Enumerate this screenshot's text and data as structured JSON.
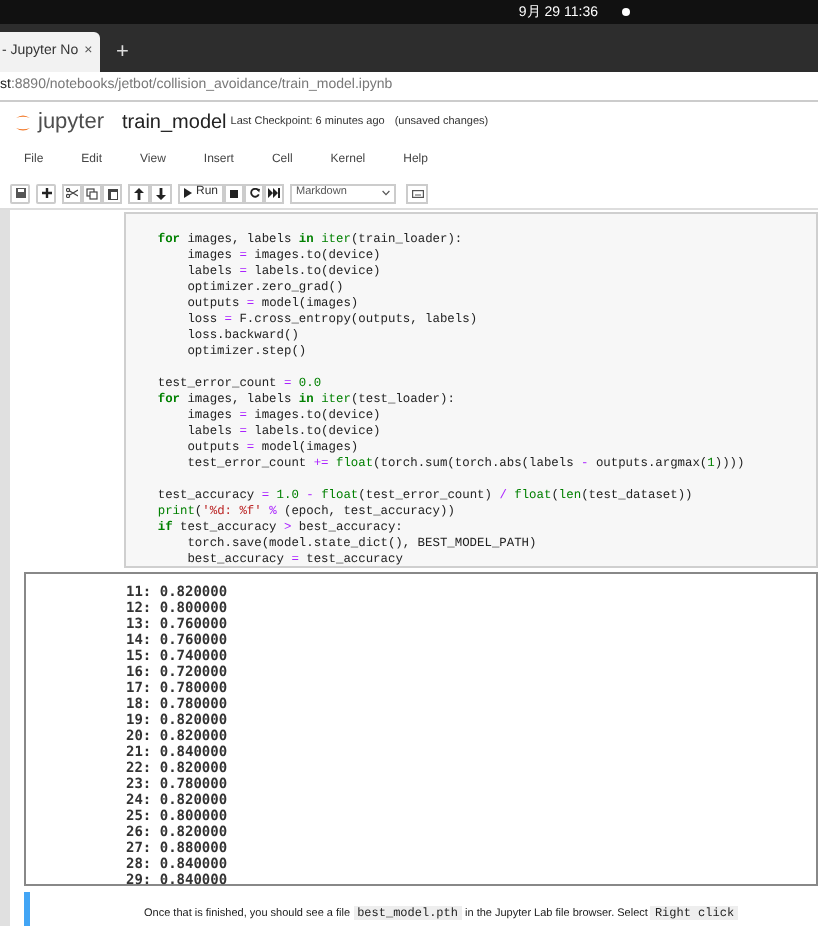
{
  "system_bar": {
    "clock": "9月 29 11:36"
  },
  "browser": {
    "tab": {
      "title": "- Jupyter No",
      "close": "×"
    },
    "new_tab": "+",
    "url": {
      "host": "st",
      "path": ":8890/notebooks/jetbot/collision_avoidance/train_model.ipynb"
    }
  },
  "header": {
    "logo": "jupyter",
    "notebook": "train_model",
    "checkpoint": "Last Checkpoint: 6 minutes ago",
    "unsaved": "(unsaved changes)"
  },
  "menu": [
    "File",
    "Edit",
    "View",
    "Insert",
    "Cell",
    "Kernel",
    "Help"
  ],
  "toolbar": {
    "run": "Run",
    "cell_type": "Markdown"
  },
  "code": [
    {
      "gap_before": false,
      "tokens": [
        {
          "kind": "kw",
          "t": "    for"
        },
        {
          "kind": "p",
          "t": " images, labels "
        },
        {
          "kind": "kw",
          "t": "in"
        },
        {
          "kind": "bi",
          "t": " iter"
        },
        {
          "kind": "p",
          "t": "(train_loader):"
        }
      ]
    },
    {
      "gap_before": false,
      "tokens": [
        {
          "kind": "p",
          "t": "        images "
        },
        {
          "kind": "op",
          "t": "="
        },
        {
          "kind": "p",
          "t": " images.to(device)"
        }
      ]
    },
    {
      "gap_before": false,
      "tokens": [
        {
          "kind": "p",
          "t": "        labels "
        },
        {
          "kind": "op",
          "t": "="
        },
        {
          "kind": "p",
          "t": " labels.to(device)"
        }
      ]
    },
    {
      "gap_before": false,
      "tokens": [
        {
          "kind": "p",
          "t": "        optimizer.zero_grad()"
        }
      ]
    },
    {
      "gap_before": false,
      "tokens": [
        {
          "kind": "p",
          "t": "        outputs "
        },
        {
          "kind": "op",
          "t": "="
        },
        {
          "kind": "p",
          "t": " model(images)"
        }
      ]
    },
    {
      "gap_before": false,
      "tokens": [
        {
          "kind": "p",
          "t": "        loss "
        },
        {
          "kind": "op",
          "t": "="
        },
        {
          "kind": "p",
          "t": " F.cross_entropy(outputs, labels)"
        }
      ]
    },
    {
      "gap_before": false,
      "tokens": [
        {
          "kind": "p",
          "t": "        loss.backward()"
        }
      ]
    },
    {
      "gap_before": false,
      "tokens": [
        {
          "kind": "p",
          "t": "        optimizer.step()"
        }
      ]
    },
    {
      "gap_before": true,
      "tokens": [
        {
          "kind": "p",
          "t": "    test_error_count "
        },
        {
          "kind": "op",
          "t": "="
        },
        {
          "kind": "num",
          "t": " 0.0"
        }
      ]
    },
    {
      "gap_before": false,
      "tokens": [
        {
          "kind": "kw",
          "t": "    for"
        },
        {
          "kind": "p",
          "t": " images, labels "
        },
        {
          "kind": "kw",
          "t": "in"
        },
        {
          "kind": "bi",
          "t": " iter"
        },
        {
          "kind": "p",
          "t": "(test_loader):"
        }
      ]
    },
    {
      "gap_before": false,
      "tokens": [
        {
          "kind": "p",
          "t": "        images "
        },
        {
          "kind": "op",
          "t": "="
        },
        {
          "kind": "p",
          "t": " images.to(device)"
        }
      ]
    },
    {
      "gap_before": false,
      "tokens": [
        {
          "kind": "p",
          "t": "        labels "
        },
        {
          "kind": "op",
          "t": "="
        },
        {
          "kind": "p",
          "t": " labels.to(device)"
        }
      ]
    },
    {
      "gap_before": false,
      "tokens": [
        {
          "kind": "p",
          "t": "        outputs "
        },
        {
          "kind": "op",
          "t": "="
        },
        {
          "kind": "p",
          "t": " model(images)"
        }
      ]
    },
    {
      "gap_before": false,
      "tokens": [
        {
          "kind": "p",
          "t": "        test_error_count "
        },
        {
          "kind": "op",
          "t": "+="
        },
        {
          "kind": "bi",
          "t": " float"
        },
        {
          "kind": "p",
          "t": "(torch.sum(torch.abs(labels "
        },
        {
          "kind": "op",
          "t": "-"
        },
        {
          "kind": "p",
          "t": " outputs.argmax("
        },
        {
          "kind": "num",
          "t": "1"
        },
        {
          "kind": "p",
          "t": "))))"
        }
      ]
    },
    {
      "gap_before": true,
      "tokens": [
        {
          "kind": "p",
          "t": "    test_accuracy "
        },
        {
          "kind": "op",
          "t": "="
        },
        {
          "kind": "num",
          "t": " 1.0"
        },
        {
          "kind": "op",
          "t": " -"
        },
        {
          "kind": "bi",
          "t": " float"
        },
        {
          "kind": "p",
          "t": "(test_error_count) "
        },
        {
          "kind": "op",
          "t": "/"
        },
        {
          "kind": "bi",
          "t": " float"
        },
        {
          "kind": "p",
          "t": "("
        },
        {
          "kind": "bi",
          "t": "len"
        },
        {
          "kind": "p",
          "t": "(test_dataset))"
        }
      ]
    },
    {
      "gap_before": false,
      "tokens": [
        {
          "kind": "bi",
          "t": "    print"
        },
        {
          "kind": "p",
          "t": "("
        },
        {
          "kind": "str",
          "t": "'%d: %f'"
        },
        {
          "kind": "op",
          "t": " %"
        },
        {
          "kind": "p",
          "t": " (epoch, test_accuracy))"
        }
      ]
    },
    {
      "gap_before": false,
      "tokens": [
        {
          "kind": "kw",
          "t": "    if"
        },
        {
          "kind": "p",
          "t": " test_accuracy "
        },
        {
          "kind": "op",
          "t": ">"
        },
        {
          "kind": "p",
          "t": " best_accuracy:"
        }
      ]
    },
    {
      "gap_before": false,
      "tokens": [
        {
          "kind": "p",
          "t": "        torch.save(model.state_dict(), BEST_MODEL_PATH)"
        }
      ]
    },
    {
      "gap_before": false,
      "tokens": [
        {
          "kind": "p",
          "t": "        best_accuracy "
        },
        {
          "kind": "op",
          "t": "="
        },
        {
          "kind": "p",
          "t": " test_accuracy"
        }
      ]
    }
  ],
  "output": [
    "11: 0.820000",
    "12: 0.800000",
    "13: 0.760000",
    "14: 0.760000",
    "15: 0.740000",
    "16: 0.720000",
    "17: 0.780000",
    "18: 0.780000",
    "19: 0.820000",
    "20: 0.820000",
    "21: 0.840000",
    "22: 0.820000",
    "23: 0.780000",
    "24: 0.820000",
    "25: 0.800000",
    "26: 0.820000",
    "27: 0.880000",
    "28: 0.840000",
    "29: 0.840000"
  ],
  "markdown": {
    "selected": true,
    "segments": [
      {
        "kind": "text",
        "t": "Once that is finished, you should see a file "
      },
      {
        "kind": "code",
        "t": "best_model.pth"
      },
      {
        "kind": "text",
        "t": " in the Jupyter Lab file browser. Select "
      },
      {
        "kind": "code",
        "t": "Right click"
      }
    ]
  }
}
